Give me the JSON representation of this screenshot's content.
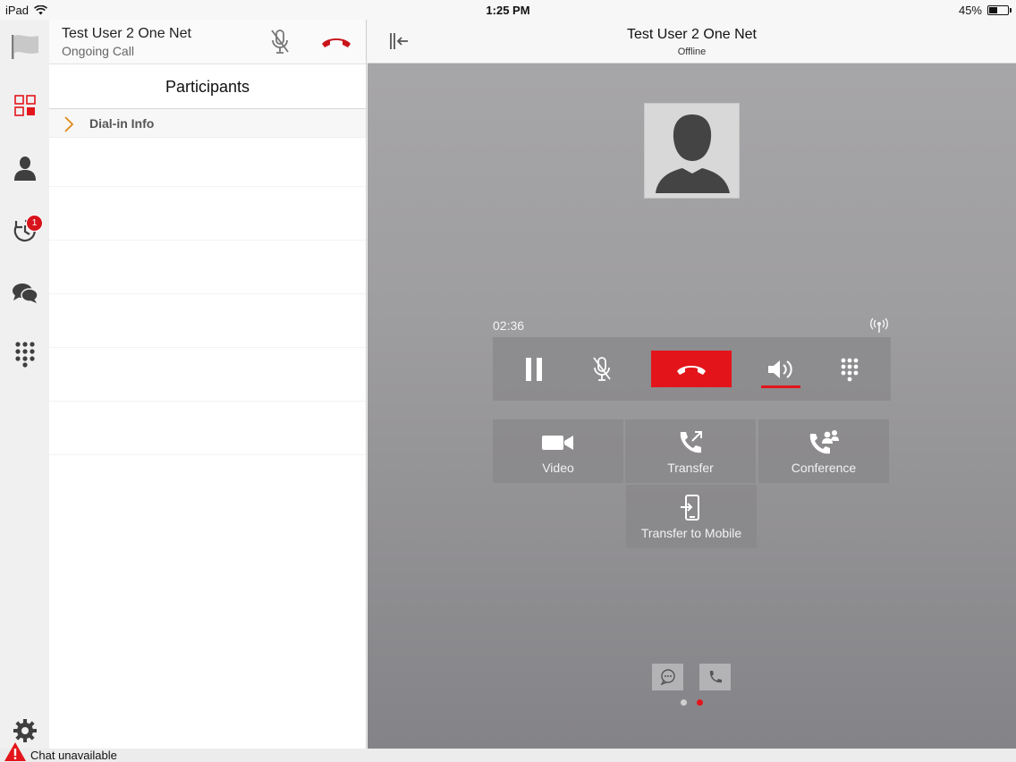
{
  "status_bar": {
    "device": "iPad",
    "time": "1:25 PM",
    "battery": "45%",
    "battery_level": 0.45
  },
  "rail": {
    "items": [
      {
        "icon": "flag-icon"
      },
      {
        "icon": "dashboard-icon"
      },
      {
        "icon": "contact-icon"
      },
      {
        "icon": "history-icon",
        "badge": "1"
      },
      {
        "icon": "chat-icon"
      },
      {
        "icon": "dialpad-icon"
      }
    ],
    "settings_icon": "gear-icon"
  },
  "call_header": {
    "name": "Test User 2 One Net",
    "status": "Ongoing Call"
  },
  "participants": {
    "title": "Participants",
    "dial_in": "Dial-in Info"
  },
  "main": {
    "title": "Test User 2 One Net",
    "presence": "Offline",
    "timer": "02:36",
    "actions": [
      "Video",
      "Transfer",
      "Conference",
      "Transfer to Mobile"
    ]
  },
  "colors": {
    "accent": "#e3151b",
    "badge": "#d7141c"
  },
  "bottom": {
    "message": "Chat unavailable"
  }
}
